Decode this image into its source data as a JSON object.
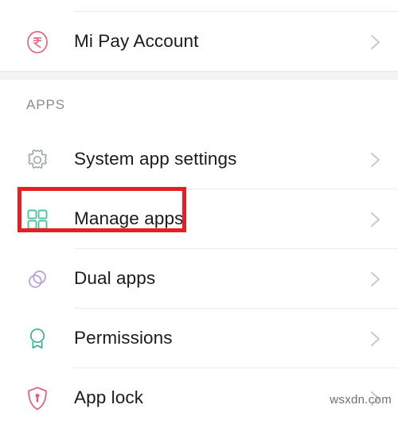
{
  "screen": {
    "background": "#ffffff",
    "watermark": "wsxdn.com"
  },
  "top_row": {
    "label": "Mi Pay Account",
    "icon": "rupee-circle-icon",
    "icon_color": "#e0607a",
    "chevron": "chevron-right-icon"
  },
  "section": {
    "header": "APPS",
    "band_color": "#f4f4f6"
  },
  "items": [
    {
      "label": "System app settings",
      "icon": "gear-icon",
      "icon_color": "#9aa3a8",
      "chevron": "chevron-right-icon",
      "highlighted": false
    },
    {
      "label": "Manage apps",
      "icon": "grid-squares-icon",
      "icon_color": "#4ec3a4",
      "chevron": "chevron-right-icon",
      "highlighted": true
    },
    {
      "label": "Dual apps",
      "icon": "overlapping-circles-icon",
      "icon_color": "#b0a0d8",
      "chevron": "chevron-right-icon",
      "highlighted": false
    },
    {
      "label": "Permissions",
      "icon": "award-badge-icon",
      "icon_color": "#3fae90",
      "chevron": "chevron-right-icon",
      "highlighted": false
    },
    {
      "label": "App lock",
      "icon": "shield-lock-icon",
      "icon_color": "#e0607a",
      "chevron": "chevron-right-icon",
      "highlighted": false
    }
  ],
  "annotation": {
    "type": "rectangle-highlight",
    "color": "#e81e25",
    "target": "Manage apps"
  }
}
